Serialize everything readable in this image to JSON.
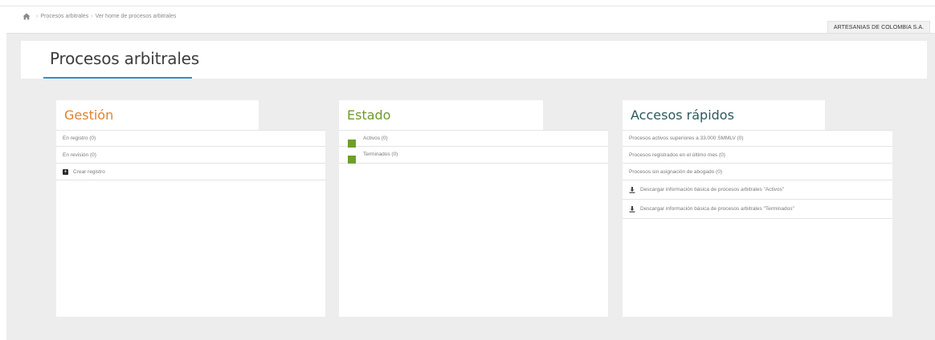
{
  "breadcrumb": {
    "items": [
      "Procesos arbitrales",
      "Ver home de procesos arbitrales"
    ]
  },
  "company": {
    "name": "ARTESANIAS DE COLOMBIA S.A."
  },
  "page": {
    "title": "Procesos arbitrales"
  },
  "gestion": {
    "title": "Gestión",
    "items": [
      "En registro (0)",
      "En revisión (0)"
    ],
    "create_label": "Crear registro"
  },
  "estado": {
    "title": "Estado",
    "items": [
      "Activos (0)",
      "Terminados (0)"
    ]
  },
  "accesos": {
    "title": "Accesos rápidos",
    "items": [
      "Procesos activos superiores a 33.000 SMMLV (0)",
      "Procesos registrados en el último mes (0)",
      "Procesos sin asignación de abogado (0)"
    ],
    "downloads": [
      "Descargar información básica de procesos arbitrales \"Activos\"",
      "Descargar información básica de procesos arbitrales \"Terminados\""
    ]
  },
  "colors": {
    "gestion_title": "#e0822b",
    "estado_title": "#6e9a2d",
    "accesos_title": "#2c5a5c",
    "estado_marker": "#6f9e2c",
    "title_underline": "#2e8fd1"
  },
  "icons": {
    "home": "home-icon",
    "create": "plus-square-icon",
    "download": "download-icon"
  }
}
